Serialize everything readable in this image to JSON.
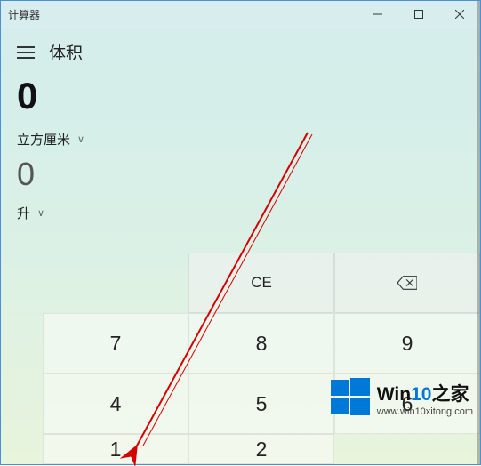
{
  "titlebar": {
    "title": "计算器"
  },
  "header": {
    "mode": "体积"
  },
  "conversion": {
    "from_value": "0",
    "from_unit": "立方厘米",
    "to_value": "0",
    "to_unit": "升"
  },
  "keypad": {
    "ce": "CE",
    "backspace_icon": "backspace-icon",
    "k7": "7",
    "k8": "8",
    "k9": "9",
    "k4": "4",
    "k5": "5",
    "k6": "6",
    "k1": "1",
    "k2": "2"
  },
  "watermark": {
    "brand_prefix": "Win",
    "brand_num": "10",
    "brand_suffix": "之家",
    "url": "www.win10xitong.com"
  }
}
